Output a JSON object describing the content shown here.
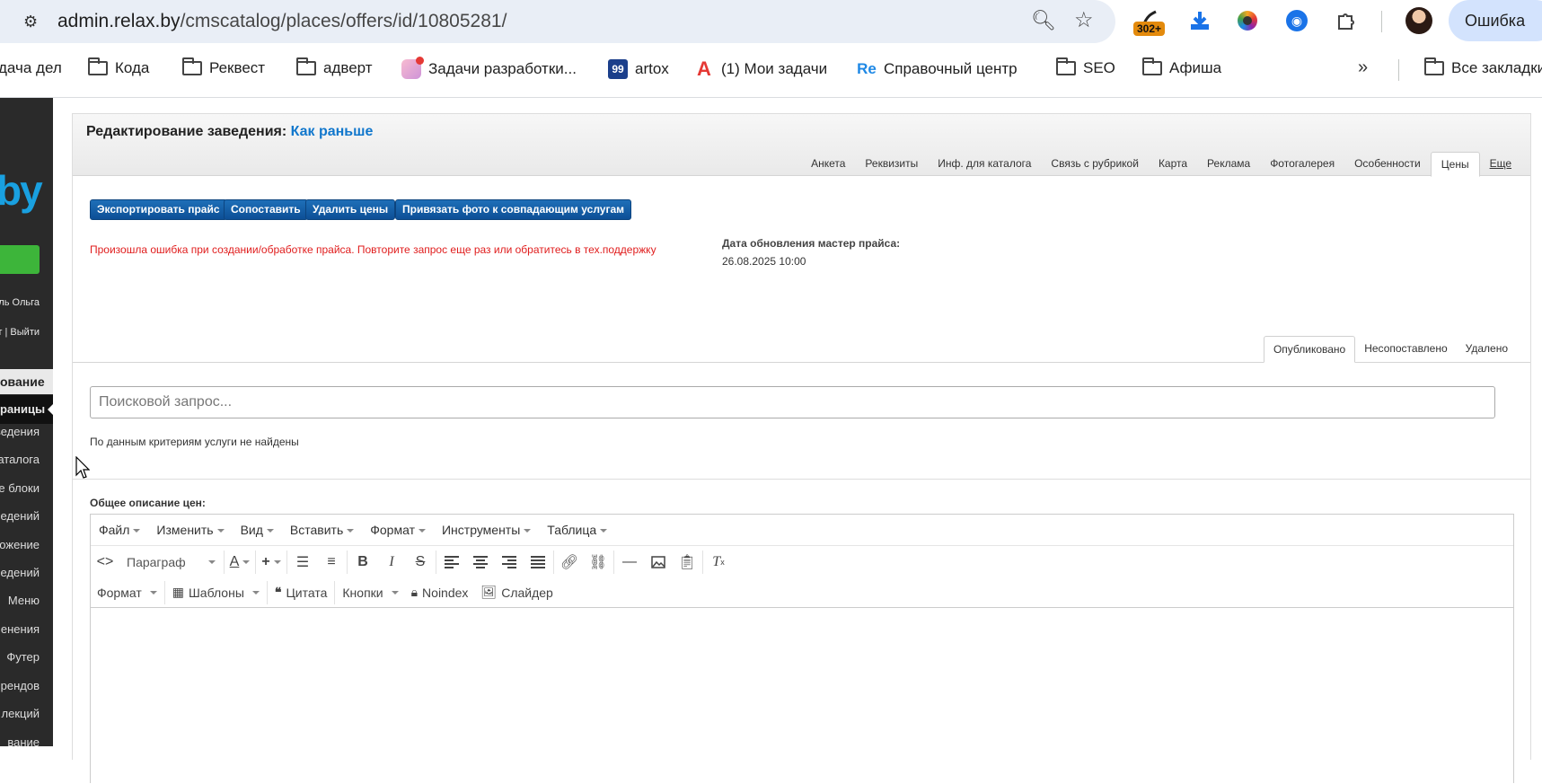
{
  "browser": {
    "url_host": "admin.relax.by",
    "url_path": "/cmscatalog/places/offers/id/10805281/",
    "ext_badge": "302+",
    "error_pill": "Ошибка"
  },
  "bookmarks": {
    "items": [
      {
        "label": "дача дел"
      },
      {
        "label": "Кода"
      },
      {
        "label": "Реквест"
      },
      {
        "label": "адверт"
      },
      {
        "label": "Задачи разработки..."
      },
      {
        "label": "artox"
      },
      {
        "label": "(1) Мои задачи"
      },
      {
        "label": "Справочный центр"
      },
      {
        "label": "SEO"
      },
      {
        "label": "Афиша"
      },
      {
        "label": "Все закладки"
      }
    ],
    "icon_99": "99",
    "icon_re": "Re",
    "icon_a": "A"
  },
  "sidebar": {
    "logo": "by",
    "user": "ль Ольга",
    "exit": "т | Выйти",
    "section": "ование",
    "active": "раницы",
    "items": [
      "ведения",
      "аталога",
      "е блоки",
      "едений",
      "ложение",
      "едений",
      "Меню",
      "енения",
      "Футер",
      "рендов",
      "лекций",
      "вание"
    ]
  },
  "panel": {
    "title_prefix": "Редактирование заведения:",
    "title_link": "Как раньше",
    "tabs": [
      "Анкета",
      "Реквизиты",
      "Инф. для каталога",
      "Связь с рубрикой",
      "Карта",
      "Реклама",
      "Фотогалерея",
      "Особенности",
      "Цены",
      "Еще"
    ],
    "active_tab": "Цены",
    "buttons": [
      "Экспортировать прайс",
      "Сопоставить",
      "Удалить цены",
      "Привязать фото к совпадающим услугам"
    ],
    "error_message": "Произошла ошибка при создании/обработке прайса. Повторите запрос еще раз или обратитесь в тех.поддержку",
    "update_label": "Дата обновления мастер прайса:",
    "update_date": "26.08.2025 10:00",
    "subtabs": [
      "Опубликовано",
      "Несопоставлено",
      "Удалено"
    ],
    "search_placeholder": "Поисковой запрос...",
    "empty_message": "По данным критериям услуги не найдены",
    "description_label": "Общее описание цен:"
  },
  "editor": {
    "menu": [
      "Файл",
      "Изменить",
      "Вид",
      "Вставить",
      "Формат",
      "Инструменты",
      "Таблица"
    ],
    "paragraph": "Параграф",
    "row2": {
      "format": "Формат",
      "templates": "Шаблоны",
      "quote": "Цитата",
      "buttons": "Кнопки",
      "noindex": "Noindex",
      "slider": "Слайдер"
    }
  }
}
